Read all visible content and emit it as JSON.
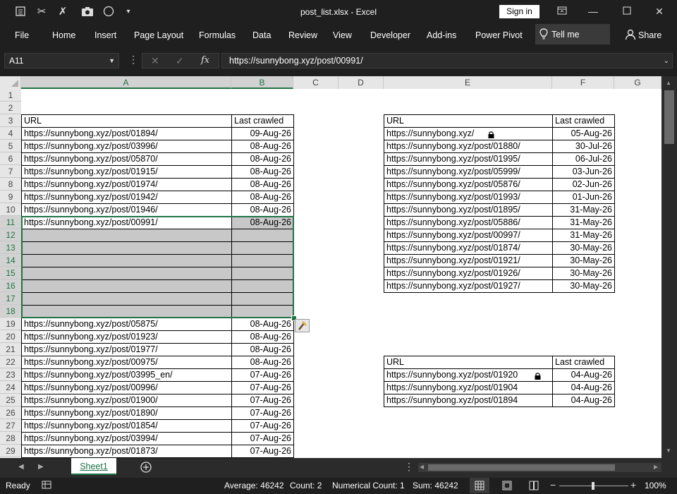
{
  "window": {
    "title": "post_list.xlsx  -  Excel",
    "signin": "Sign in"
  },
  "ribbon": {
    "tabs": [
      "File",
      "Home",
      "Insert",
      "Page Layout",
      "Formulas",
      "Data",
      "Review",
      "View",
      "Developer",
      "Add-ins",
      "Power Pivot"
    ],
    "tell_me": "Tell me",
    "share": "Share"
  },
  "formula_bar": {
    "name_box": "A11",
    "fx": "fx",
    "value": "https://sunnybong.xyz/post/00991/"
  },
  "columns": [
    "A",
    "B",
    "C",
    "D",
    "E",
    "F",
    "G"
  ],
  "rows": [
    "1",
    "2",
    "3",
    "4",
    "5",
    "6",
    "7",
    "8",
    "9",
    "10",
    "11",
    "12",
    "13",
    "14",
    "15",
    "16",
    "17",
    "18",
    "19",
    "20",
    "21",
    "22",
    "23",
    "24",
    "25",
    "26",
    "27",
    "28",
    "29"
  ],
  "table1": {
    "headers": [
      "URL",
      "Last crawled"
    ],
    "rows": [
      [
        "https://sunnybong.xyz/post/01894/",
        "09-Aug-26"
      ],
      [
        "https://sunnybong.xyz/post/03996/",
        "08-Aug-26"
      ],
      [
        "https://sunnybong.xyz/post/05870/",
        "08-Aug-26"
      ],
      [
        "https://sunnybong.xyz/post/01915/",
        "08-Aug-26"
      ],
      [
        "https://sunnybong.xyz/post/01974/",
        "08-Aug-26"
      ],
      [
        "https://sunnybong.xyz/post/01942/",
        "08-Aug-26"
      ],
      [
        "https://sunnybong.xyz/post/01946/",
        "08-Aug-26"
      ],
      [
        "https://sunnybong.xyz/post/00991/",
        "08-Aug-26"
      ],
      [
        "",
        ""
      ],
      [
        "",
        ""
      ],
      [
        "",
        ""
      ],
      [
        "",
        ""
      ],
      [
        "",
        ""
      ],
      [
        "",
        ""
      ],
      [
        "",
        ""
      ],
      [
        "https://sunnybong.xyz/post/05875/",
        "08-Aug-26"
      ],
      [
        "https://sunnybong.xyz/post/01923/",
        "08-Aug-26"
      ],
      [
        "https://sunnybong.xyz/post/01977/",
        "08-Aug-26"
      ],
      [
        "https://sunnybong.xyz/post/00975/",
        "08-Aug-26"
      ],
      [
        "https://sunnybong.xyz/post/03995_en/",
        "07-Aug-26"
      ],
      [
        "https://sunnybong.xyz/post/00996/",
        "07-Aug-26"
      ],
      [
        "https://sunnybong.xyz/post/01900/",
        "07-Aug-26"
      ],
      [
        "https://sunnybong.xyz/post/01890/",
        "07-Aug-26"
      ],
      [
        "https://sunnybong.xyz/post/01854/",
        "07-Aug-26"
      ],
      [
        "https://sunnybong.xyz/post/03994/",
        "07-Aug-26"
      ],
      [
        "https://sunnybong.xyz/post/01873/",
        "07-Aug-26"
      ]
    ]
  },
  "table2": {
    "headers": [
      "URL",
      "Last crawled"
    ],
    "rows": [
      [
        "https://sunnybong.xyz/",
        "05-Aug-26"
      ],
      [
        "https://sunnybong.xyz/post/01880/",
        "30-Jul-26"
      ],
      [
        "https://sunnybong.xyz/post/01995/",
        "06-Jul-26"
      ],
      [
        "https://sunnybong.xyz/post/05999/",
        "03-Jun-26"
      ],
      [
        "https://sunnybong.xyz/post/05876/",
        "02-Jun-26"
      ],
      [
        "https://sunnybong.xyz/post/01993/",
        "01-Jun-26"
      ],
      [
        "https://sunnybong.xyz/post/01895/",
        "31-May-26"
      ],
      [
        "https://sunnybong.xyz/post/05886/",
        "31-May-26"
      ],
      [
        "https://sunnybong.xyz/post/00997/",
        "31-May-26"
      ],
      [
        "https://sunnybong.xyz/post/01874/",
        "30-May-26"
      ],
      [
        "https://sunnybong.xyz/post/01921/",
        "30-May-26"
      ],
      [
        "https://sunnybong.xyz/post/01926/",
        "30-May-26"
      ],
      [
        "https://sunnybong.xyz/post/01927/",
        "30-May-26"
      ]
    ]
  },
  "table3": {
    "headers": [
      "URL",
      "Last crawled"
    ],
    "rows": [
      [
        "https://sunnybong.xyz/post/01920",
        "04-Aug-26"
      ],
      [
        "https://sunnybong.xyz/post/01904",
        "04-Aug-26"
      ],
      [
        "https://sunnybong.xyz/post/01894",
        "04-Aug-26"
      ]
    ]
  },
  "sheets": [
    "Sheet1"
  ],
  "status": {
    "ready": "Ready",
    "average": "Average: 46242",
    "count": "Count: 2",
    "numerical_count": "Numerical Count: 1",
    "sum": "Sum: 46242",
    "zoom": "100%"
  },
  "colors": {
    "accent": "#217346",
    "sheet_tab_text": "#217346",
    "chrome": "#1f1f1f"
  }
}
